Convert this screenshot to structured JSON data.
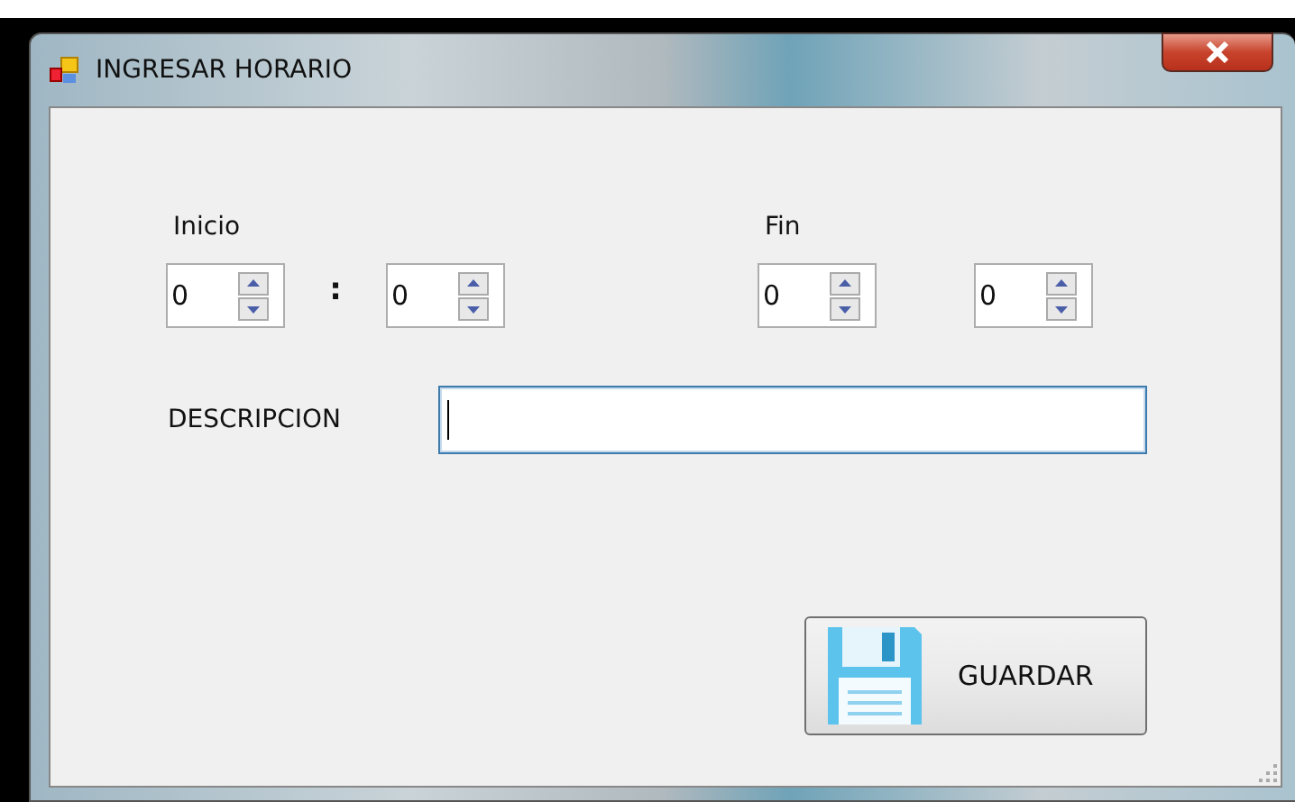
{
  "window": {
    "title": "INGRESAR HORARIO"
  },
  "start": {
    "label": "Inicio",
    "separator": ":",
    "spinners": [
      {
        "value": "0"
      },
      {
        "value": "0"
      }
    ]
  },
  "end": {
    "label": "Fin",
    "spinners": [
      {
        "value": "0"
      },
      {
        "value": "0"
      }
    ]
  },
  "description": {
    "label": "DESCRIPCION",
    "focused": true
  },
  "save_button": {
    "label": "GUARDAR"
  }
}
